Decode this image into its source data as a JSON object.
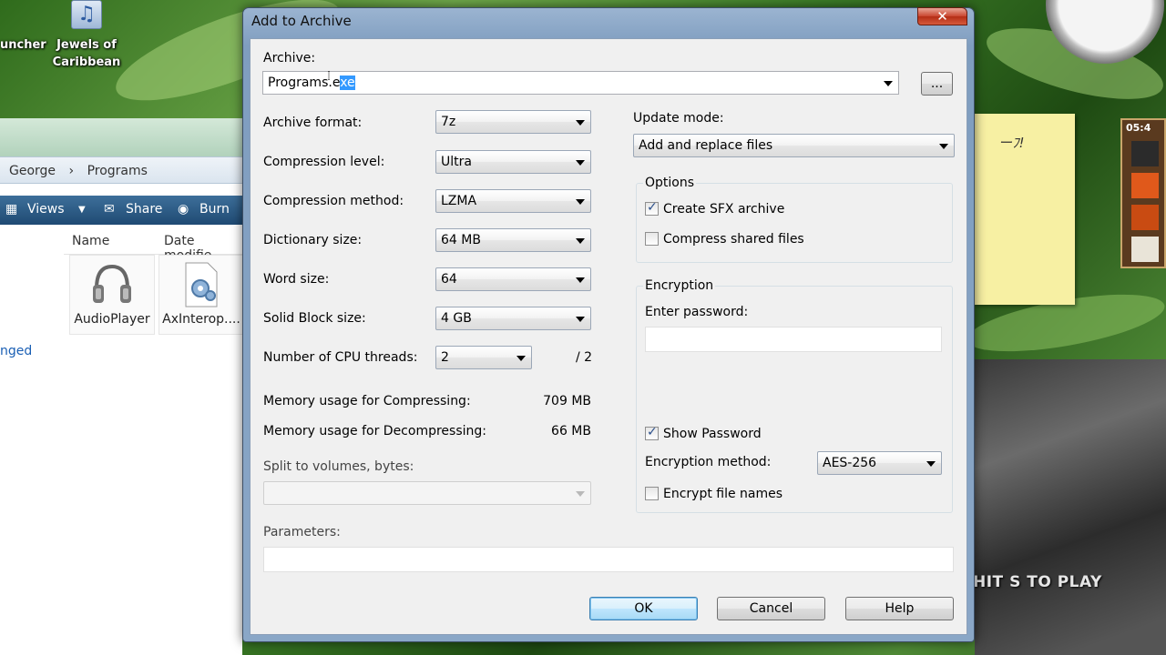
{
  "desktop": {
    "icon_launcher_label": "uncher",
    "icon_jewels_label_1": "Jewels of",
    "icon_jewels_label_2": "Caribbean",
    "note_text": "ーﾌ!",
    "puzzle_time": "05:4",
    "game_text": "HIT S TO PLAY"
  },
  "explorer": {
    "breadcrumb": [
      "George",
      "Programs"
    ],
    "toolbar": {
      "views": "Views",
      "share": "Share",
      "burn": "Burn"
    },
    "columns": {
      "name": "Name",
      "date": "Date modifie"
    },
    "nav_partial": "nged",
    "files": [
      {
        "label": "AudioPlayer",
        "icon": "headphones-icon"
      },
      {
        "label": "AxInterop....",
        "icon": "settings-file-icon"
      }
    ]
  },
  "dialog": {
    "title": "Add to Archive",
    "close_label": "✕",
    "archive_label": "Archive:",
    "archive_value_plain": "Programs.e",
    "archive_value_selected": "xe",
    "browse_label": "...",
    "archive_format_label": "Archive format:",
    "archive_format_value": "7z",
    "compression_level_label": "Compression level:",
    "compression_level_value": "Ultra",
    "compression_method_label": "Compression method:",
    "compression_method_value": "LZMA",
    "dictionary_size_label": "Dictionary size:",
    "dictionary_size_value": "64 MB",
    "word_size_label": "Word size:",
    "word_size_value": "64",
    "solid_block_label": "Solid Block size:",
    "solid_block_value": "4 GB",
    "cpu_threads_label": "Number of CPU threads:",
    "cpu_threads_value": "2",
    "cpu_threads_total": "/ 2",
    "mem_compress_label": "Memory usage for Compressing:",
    "mem_compress_value": "709 MB",
    "mem_decompress_label": "Memory usage for Decompressing:",
    "mem_decompress_value": "66 MB",
    "split_label": "Split to volumes, bytes:",
    "split_value": "",
    "parameters_label": "Parameters:",
    "parameters_value": "",
    "update_mode_label": "Update mode:",
    "update_mode_value": "Add and replace files",
    "options_label": "Options",
    "create_sfx_label": "Create SFX archive",
    "create_sfx_checked": true,
    "compress_shared_label": "Compress shared files",
    "compress_shared_checked": false,
    "encryption_label": "Encryption",
    "enter_password_label": "Enter password:",
    "password_value": "",
    "show_password_label": "Show Password",
    "show_password_checked": true,
    "encryption_method_label": "Encryption method:",
    "encryption_method_value": "AES-256",
    "encrypt_names_label": "Encrypt file names",
    "encrypt_names_checked": false,
    "ok_label": "OK",
    "cancel_label": "Cancel",
    "help_label": "Help"
  },
  "colors": {
    "dialog_frame": "#8aa7c7",
    "client_bg": "#f0f0f0",
    "selection": "#3399ff",
    "close_button": "#c9452f"
  }
}
